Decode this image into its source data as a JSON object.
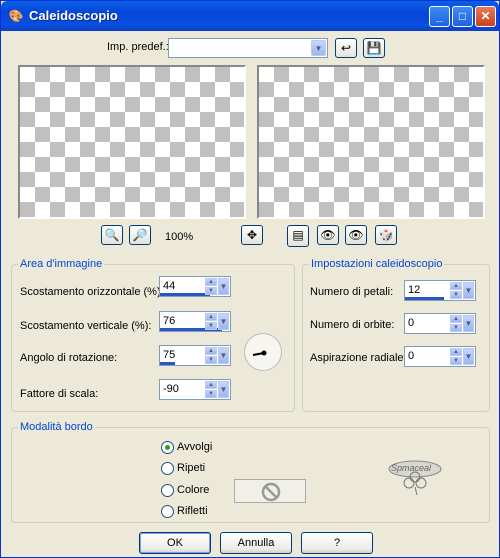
{
  "window": {
    "title": "Caleidoscopio",
    "title_icon": "paint-shop-icon",
    "min": "_",
    "max": "□",
    "close": "✕"
  },
  "preset": {
    "label": "Imp. predef.:",
    "value": ""
  },
  "zoom": {
    "value": "100%"
  },
  "area": {
    "title": "Area d'immagine",
    "h_offset": {
      "label": "Scostamento orizzontale (%):",
      "value": "44",
      "fill": 0.72
    },
    "v_offset": {
      "label": "Scostamento verticale (%):",
      "value": "76",
      "fill": 0.88
    },
    "angle": {
      "label": "Angolo di rotazione:",
      "value": "75",
      "fill": 0.21
    },
    "scale": {
      "label": "Fattore di scala:",
      "value": "-90",
      "fill": 0
    }
  },
  "kaleido": {
    "title": "Impostazioni caleidoscopio",
    "petals": {
      "label": "Numero di petali:",
      "value": "12",
      "fill": 0.55
    },
    "orbits": {
      "label": "Numero di orbite:",
      "value": "0",
      "fill": 0
    },
    "spiral": {
      "label": "Aspirazione radiale:",
      "value": "0",
      "fill": 0
    }
  },
  "edge": {
    "title": "Modalità bordo",
    "options": [
      "Avvolgi",
      "Ripeti",
      "Colore",
      "Rifletti"
    ],
    "selected": "Avvolgi"
  },
  "watermark": "Spmaceal",
  "buttons": {
    "ok": "OK",
    "cancel": "Annulla",
    "help": "?"
  }
}
